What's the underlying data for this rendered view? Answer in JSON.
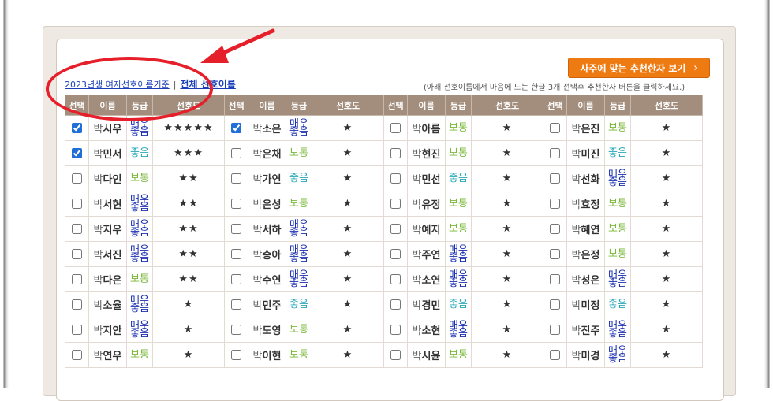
{
  "button": {
    "label": "사주에 맞는 추천한자 보기",
    "chevron": "›"
  },
  "filter": {
    "link_year": "2023년생 여자선호이름기준",
    "separator": "|",
    "link_all": "전체 선호이름"
  },
  "hint": "(아래 선호이름에서 마음에 드는 한글 3개 선택후 추천한자 버튼을 클릭하세요.)",
  "headers": [
    "선택",
    "이름",
    "등급",
    "선호도",
    "선택",
    "이름",
    "등급",
    "선호도",
    "선택",
    "이름",
    "등급",
    "선호도",
    "선택",
    "이름",
    "등급",
    "선호도"
  ],
  "grades": {
    "bt": "보통",
    "jo": "좋음",
    "mj1": "매우",
    "mj2": "좋음"
  },
  "rows": [
    [
      {
        "s": "박",
        "n": "시우",
        "g": "mj",
        "stars": "★★★★★",
        "c": true
      },
      {
        "s": "박",
        "n": "소은",
        "g": "mj",
        "stars": "★",
        "c": true
      },
      {
        "s": "박",
        "n": "아름",
        "g": "bt",
        "stars": "★",
        "c": false
      },
      {
        "s": "박",
        "n": "은진",
        "g": "bt",
        "stars": "★",
        "c": false
      }
    ],
    [
      {
        "s": "박",
        "n": "민서",
        "g": "jo",
        "stars": "★★★",
        "c": true
      },
      {
        "s": "박",
        "n": "은채",
        "g": "bt",
        "stars": "★",
        "c": false
      },
      {
        "s": "박",
        "n": "현진",
        "g": "bt",
        "stars": "★",
        "c": false
      },
      {
        "s": "박",
        "n": "미진",
        "g": "jo",
        "stars": "★",
        "c": false
      }
    ],
    [
      {
        "s": "박",
        "n": "다인",
        "g": "bt",
        "stars": "★★",
        "c": false
      },
      {
        "s": "박",
        "n": "가연",
        "g": "jo",
        "stars": "★",
        "c": false
      },
      {
        "s": "박",
        "n": "민선",
        "g": "jo",
        "stars": "★",
        "c": false
      },
      {
        "s": "박",
        "n": "선화",
        "g": "mj",
        "stars": "★",
        "c": false
      }
    ],
    [
      {
        "s": "박",
        "n": "서현",
        "g": "mj",
        "stars": "★★",
        "c": false
      },
      {
        "s": "박",
        "n": "은성",
        "g": "bt",
        "stars": "★",
        "c": false
      },
      {
        "s": "박",
        "n": "유정",
        "g": "bt",
        "stars": "★",
        "c": false
      },
      {
        "s": "박",
        "n": "효정",
        "g": "bt",
        "stars": "★",
        "c": false
      }
    ],
    [
      {
        "s": "박",
        "n": "지우",
        "g": "mj",
        "stars": "★★",
        "c": false
      },
      {
        "s": "박",
        "n": "서하",
        "g": "mj",
        "stars": "★",
        "c": false
      },
      {
        "s": "박",
        "n": "예지",
        "g": "bt",
        "stars": "★",
        "c": false
      },
      {
        "s": "박",
        "n": "혜연",
        "g": "bt",
        "stars": "★",
        "c": false
      }
    ],
    [
      {
        "s": "박",
        "n": "서진",
        "g": "mj",
        "stars": "★★",
        "c": false
      },
      {
        "s": "박",
        "n": "승아",
        "g": "mj",
        "stars": "★",
        "c": false
      },
      {
        "s": "박",
        "n": "주연",
        "g": "mj",
        "stars": "★",
        "c": false
      },
      {
        "s": "박",
        "n": "은정",
        "g": "bt",
        "stars": "★",
        "c": false
      }
    ],
    [
      {
        "s": "박",
        "n": "다은",
        "g": "bt",
        "stars": "★★",
        "c": false
      },
      {
        "s": "박",
        "n": "수연",
        "g": "mj",
        "stars": "★",
        "c": false
      },
      {
        "s": "박",
        "n": "소연",
        "g": "mj",
        "stars": "★",
        "c": false
      },
      {
        "s": "박",
        "n": "성은",
        "g": "mj",
        "stars": "★",
        "c": false
      }
    ],
    [
      {
        "s": "박",
        "n": "소율",
        "g": "mj",
        "stars": "★",
        "c": false
      },
      {
        "s": "박",
        "n": "민주",
        "g": "jo",
        "stars": "★",
        "c": false
      },
      {
        "s": "박",
        "n": "경민",
        "g": "jo",
        "stars": "★",
        "c": false
      },
      {
        "s": "박",
        "n": "미정",
        "g": "jo",
        "stars": "★",
        "c": false
      }
    ],
    [
      {
        "s": "박",
        "n": "지안",
        "g": "mj",
        "stars": "★",
        "c": false
      },
      {
        "s": "박",
        "n": "도영",
        "g": "bt",
        "stars": "★",
        "c": false
      },
      {
        "s": "박",
        "n": "소현",
        "g": "mj",
        "stars": "★",
        "c": false
      },
      {
        "s": "박",
        "n": "진주",
        "g": "mj",
        "stars": "★",
        "c": false
      }
    ],
    [
      {
        "s": "박",
        "n": "연우",
        "g": "bt",
        "stars": "★",
        "c": false
      },
      {
        "s": "박",
        "n": "이현",
        "g": "bt",
        "stars": "★",
        "c": false
      },
      {
        "s": "박",
        "n": "시윤",
        "g": "bt",
        "stars": "★",
        "c": false
      },
      {
        "s": "박",
        "n": "미경",
        "g": "mj",
        "stars": "★",
        "c": false
      }
    ]
  ],
  "colors": {
    "header_bg": "#a38e7e",
    "button_bg": "#ee7a12",
    "annotation_red": "#e5202a",
    "star": "#f2a21a"
  }
}
